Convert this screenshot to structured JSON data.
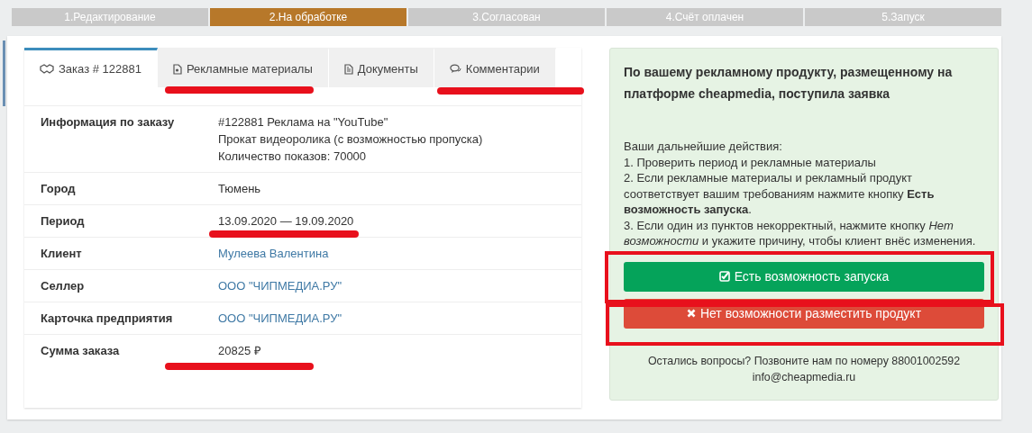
{
  "steps": [
    {
      "label": "1.Редактирование",
      "selected": false
    },
    {
      "label": "2.На обработке",
      "selected": true
    },
    {
      "label": "3.Согласован",
      "selected": false
    },
    {
      "label": "4.Счёт оплачен",
      "selected": false
    },
    {
      "label": "5.Запуск",
      "selected": false
    }
  ],
  "tabs": [
    {
      "label": "Заказ # 122881",
      "selected": true
    },
    {
      "label": "Рекламные материалы",
      "selected": false
    },
    {
      "label": "Документы",
      "selected": false
    },
    {
      "label": "Комментарии",
      "selected": false
    }
  ],
  "order_details": [
    {
      "label": "Информация по заказу",
      "kind": "text",
      "lines": [
        "#122881 Реклама на \"YouTube\"",
        "Прокат видеоролика (с возможностью пропуска)",
        "Количество показов: 70000"
      ]
    },
    {
      "label": "Город",
      "kind": "text",
      "lines": [
        "Тюмень"
      ]
    },
    {
      "label": "Период",
      "kind": "text",
      "lines": [
        "13.09.2020 — 19.09.2020"
      ]
    },
    {
      "label": "Клиент",
      "kind": "link",
      "lines": [
        "Мулеева Валентина"
      ]
    },
    {
      "label": "Селлер",
      "kind": "link",
      "lines": [
        "ООО \"ЧИПМЕДИА.РУ\""
      ]
    },
    {
      "label": "Карточка предприятия",
      "kind": "link",
      "lines": [
        "ООО \"ЧИПМЕДИА.РУ\""
      ]
    },
    {
      "label": "Сумма заказа",
      "kind": "text",
      "lines": [
        "20825 ₽"
      ]
    }
  ],
  "notice": {
    "title": "По вашему рекламному продукту, размещенному на платформе cheapmedia, поступила заявка",
    "lines": [
      "Ваши дальнейшие действия:",
      "1. Проверить период и рекламные материалы",
      "2. Если рекламные материалы и рекламный продукт соответствует вашим требованиям нажмите кнопку **Есть возможность запуска**.",
      "3. Если один из пунктов некорректный, нажмите кнопку *Нет возможности* и укажите причину, чтобы клиент внёс изменения."
    ],
    "buttons": [
      {
        "label": "Есть возможность запуска",
        "kind": "accept"
      },
      {
        "label": "Нет возможности разместить продукт",
        "kind": "reject"
      }
    ],
    "contact": [
      "Остались вопросы? Позвоните нам по номеру 88001002592",
      "info@cheapmedia.ru"
    ]
  }
}
